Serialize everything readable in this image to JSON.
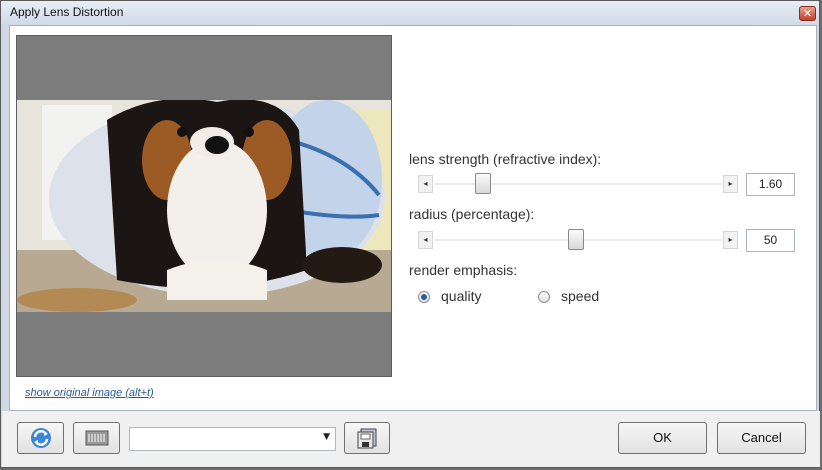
{
  "window": {
    "title": "Apply Lens Distortion",
    "close_glyph": "✕"
  },
  "preview": {
    "show_original_link": "show original image (alt+t)"
  },
  "controls": {
    "lens_strength": {
      "label": "lens strength (refractive index):",
      "value": "1.60",
      "position": 0.2
    },
    "radius": {
      "label": "radius (percentage):",
      "value": "50",
      "position": 0.5
    },
    "render_emphasis": {
      "label": "render emphasis:",
      "options": [
        {
          "label": "quality",
          "selected": true
        },
        {
          "label": "speed",
          "selected": false
        }
      ]
    }
  },
  "footer": {
    "ok_label": "OK",
    "cancel_label": "Cancel",
    "preset_combo_value": "",
    "icons": [
      "refresh-icon",
      "preview-mode-icon",
      "save-preset-icon"
    ]
  },
  "colors": {
    "accent": "#2a5a94",
    "radio_selected": "#2b5c9c"
  }
}
